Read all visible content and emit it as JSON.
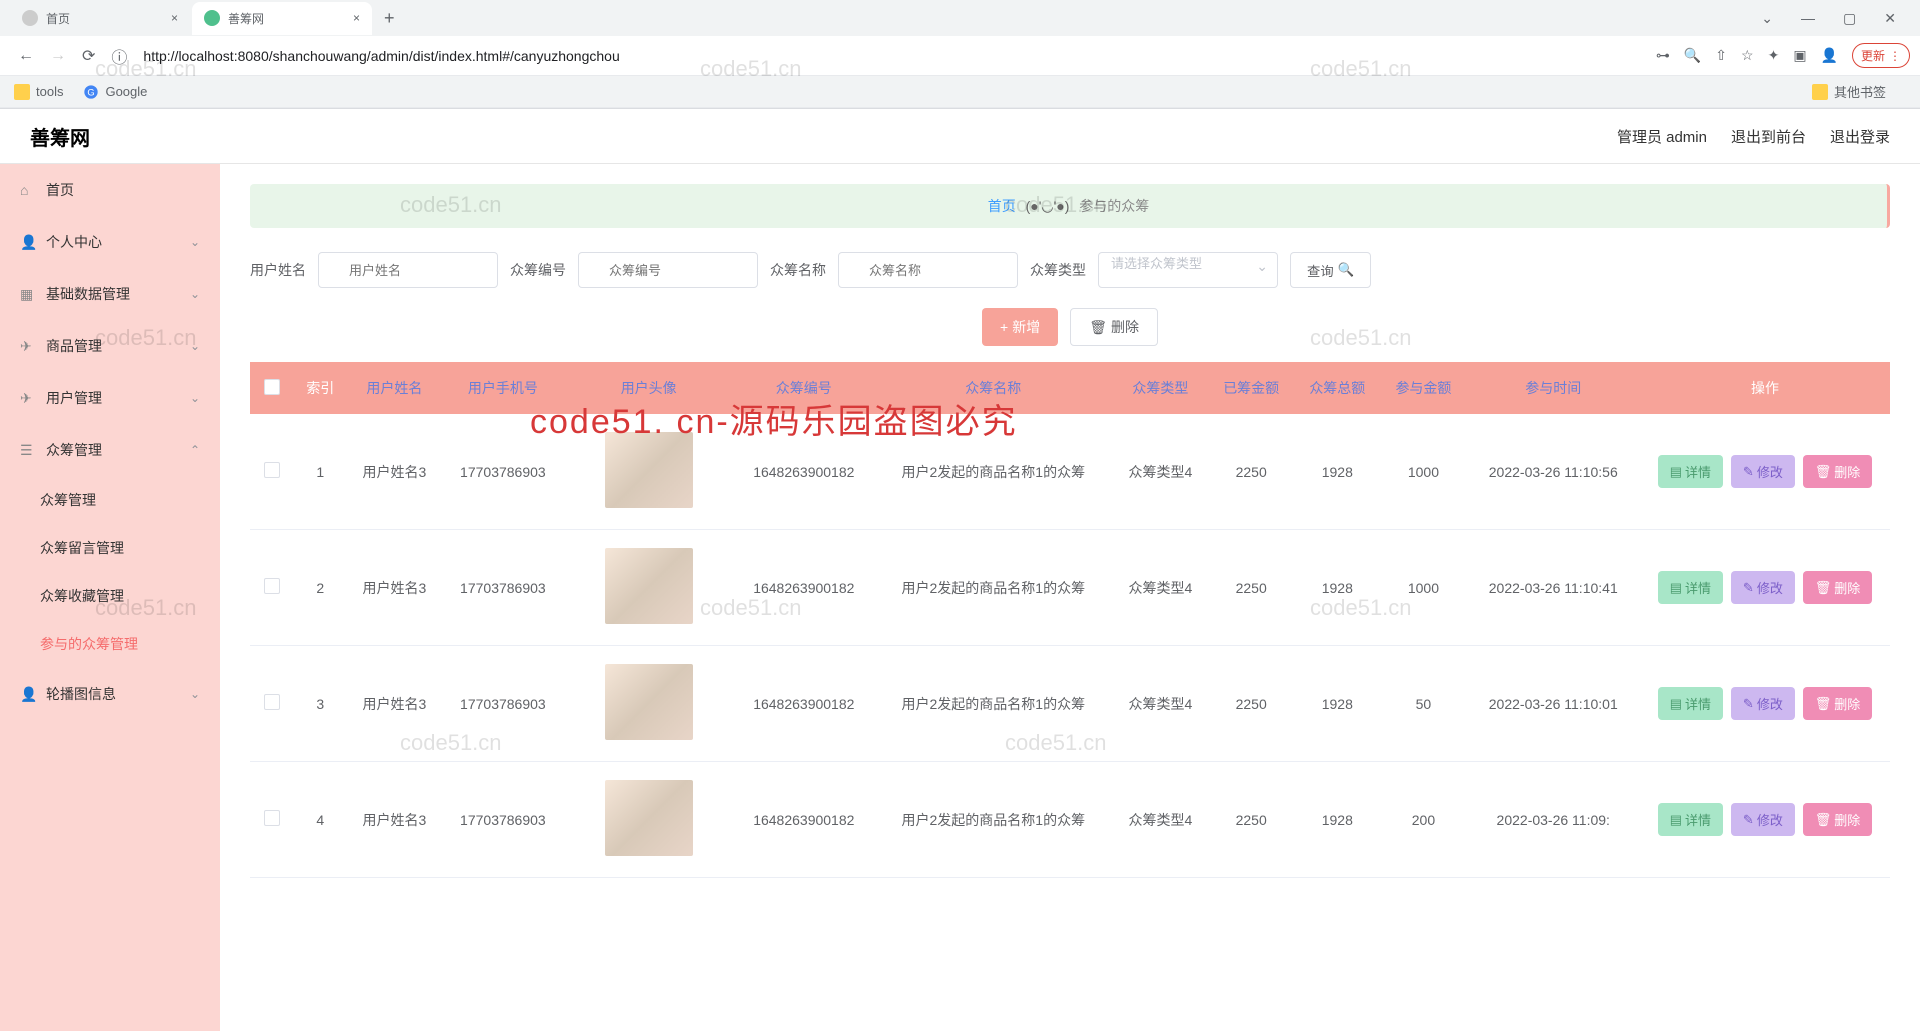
{
  "browser": {
    "tab1_title": "首页",
    "tab2_title": "善筹网",
    "url": "http://localhost:8080/shanchouwang/admin/dist/index.html#/canyuzhongchou",
    "update_label": "更新",
    "bm_tools": "tools",
    "bm_google": "Google",
    "bm_other": "其他书签"
  },
  "header": {
    "app_title": "善筹网",
    "admin_label": "管理员 admin",
    "frontend_label": "退出到前台",
    "logout_label": "退出登录"
  },
  "sidebar": {
    "home": "首页",
    "personal": "个人中心",
    "basic_data": "基础数据管理",
    "product": "商品管理",
    "user": "用户管理",
    "crowdfund": "众筹管理",
    "sub_cf_manage": "众筹管理",
    "sub_cf_message": "众筹留言管理",
    "sub_cf_collect": "众筹收藏管理",
    "sub_cf_join": "参与的众筹管理",
    "carousel": "轮播图信息"
  },
  "breadcrumb": {
    "home": "首页",
    "emoji": "(●'◡'●)",
    "current": "参与的众筹"
  },
  "filters": {
    "name_label": "用户姓名",
    "name_ph": "用户姓名",
    "code_label": "众筹编号",
    "code_ph": "众筹编号",
    "cfname_label": "众筹名称",
    "cfname_ph": "众筹名称",
    "type_label": "众筹类型",
    "type_ph": "请选择众筹类型",
    "query_btn": "查询"
  },
  "actions": {
    "add": "新增",
    "delete": "删除"
  },
  "table": {
    "headers": {
      "index": "索引",
      "username": "用户姓名",
      "phone": "用户手机号",
      "avatar": "用户头像",
      "code": "众筹编号",
      "cfname": "众筹名称",
      "cftype": "众筹类型",
      "raised": "已筹金额",
      "total": "众筹总额",
      "join_amount": "参与金额",
      "join_time": "参与时间",
      "actions": "操作"
    },
    "row_btns": {
      "detail": "详情",
      "edit": "修改",
      "delete": "删除"
    },
    "rows": [
      {
        "idx": "1",
        "username": "用户姓名3",
        "phone": "17703786903",
        "code": "1648263900182",
        "cfname": "用户2发起的商品名称1的众筹",
        "cftype": "众筹类型4",
        "raised": "2250",
        "total": "1928",
        "join_amount": "1000",
        "join_time": "2022-03-26 11:10:56"
      },
      {
        "idx": "2",
        "username": "用户姓名3",
        "phone": "17703786903",
        "code": "1648263900182",
        "cfname": "用户2发起的商品名称1的众筹",
        "cftype": "众筹类型4",
        "raised": "2250",
        "total": "1928",
        "join_amount": "1000",
        "join_time": "2022-03-26 11:10:41"
      },
      {
        "idx": "3",
        "username": "用户姓名3",
        "phone": "17703786903",
        "code": "1648263900182",
        "cfname": "用户2发起的商品名称1的众筹",
        "cftype": "众筹类型4",
        "raised": "2250",
        "total": "1928",
        "join_amount": "50",
        "join_time": "2022-03-26 11:10:01"
      },
      {
        "idx": "4",
        "username": "用户姓名3",
        "phone": "17703786903",
        "code": "1648263900182",
        "cfname": "用户2发起的商品名称1的众筹",
        "cftype": "众筹类型4",
        "raised": "2250",
        "total": "1928",
        "join_amount": "200",
        "join_time": "2022-03-26 11:09:"
      }
    ]
  },
  "watermark": "code51.cn",
  "watermark_big": "code51. cn-源码乐园盗图必究"
}
